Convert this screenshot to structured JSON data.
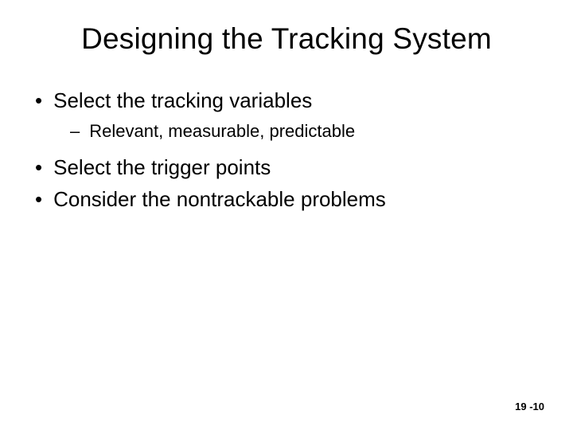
{
  "title": "Designing the Tracking System",
  "bullets": {
    "b1": "Select the tracking variables",
    "b1sub1": "Relevant, measurable, predictable",
    "b2": "Select the trigger points",
    "b3": "Consider the nontrackable problems"
  },
  "footer": "19 -10"
}
